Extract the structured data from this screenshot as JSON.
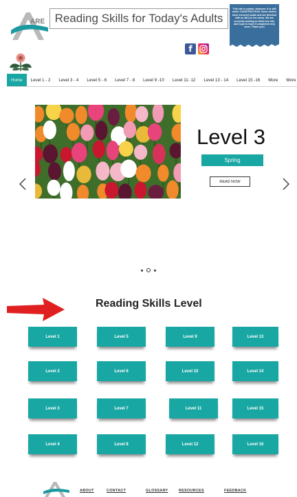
{
  "header": {
    "logo_text": "ARE",
    "title": "Reading Skills for Today's Adults",
    "notice": "This site is usable. However, it is still under CONSTRUCTION. Some stories have incorrect audio and are denoted with an (NC) in the menu. We are currently working to finish the site, and hope to have it completed very soon. Thank you!",
    "social": {
      "facebook": "f",
      "instagram": "instagram-icon"
    }
  },
  "nav": {
    "items": [
      "Home",
      "Level 1 - 2",
      "Level 3 - 4",
      "Level 5 - 6",
      "Level 7 - 8",
      "Level 9 -10",
      "Level 11- 12",
      "Level 13 - 14",
      "Level 15 -16",
      "More",
      "More"
    ],
    "active_index": 0
  },
  "slider": {
    "title": "Level 3",
    "subtitle": "Spring",
    "button_label": "READ NOW",
    "slide_count": 3,
    "current_slide": 2
  },
  "levels": {
    "heading": "Reading Skills Level",
    "buttons": [
      "Level 1",
      "Level 2",
      "Level 3",
      "Level 4",
      "Level 5",
      "Level 6",
      "Level 7",
      "Level 8",
      "Level 9",
      "Level 10",
      "Level 11",
      "Level 12",
      "Level 13",
      "Level 14",
      "Level 15",
      "Level 16"
    ]
  },
  "footer": {
    "links": [
      "ABOUT",
      "CONTACT",
      "GLOSSARY",
      "RESOURCES",
      "FEEDBACK"
    ]
  },
  "colors": {
    "accent": "#19a7a4",
    "notice_blue": "#3a6e9c",
    "arrow_red": "#e02020"
  }
}
